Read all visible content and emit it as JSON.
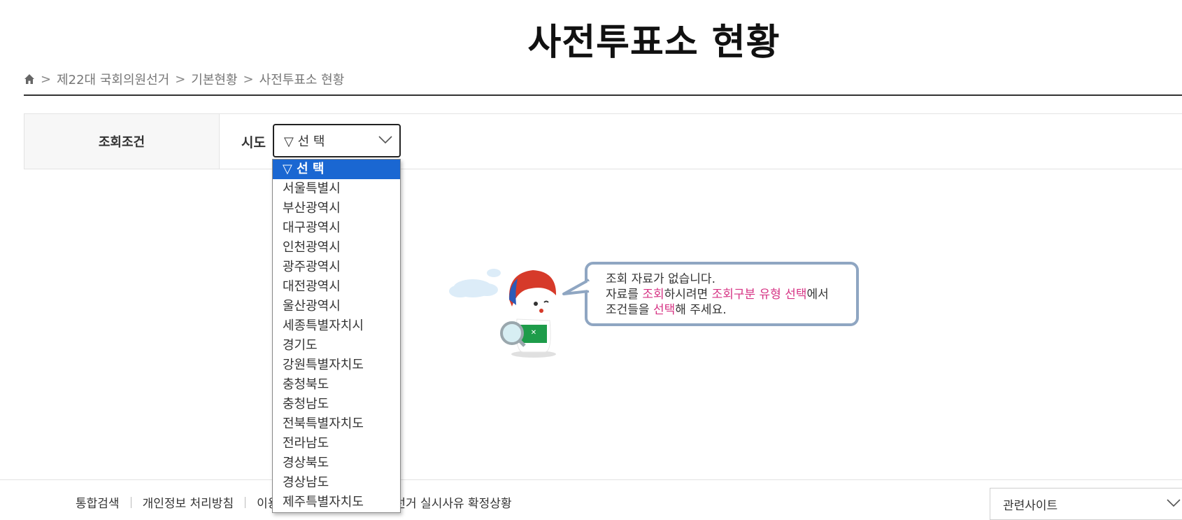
{
  "page": {
    "title": "사전투표소 현황"
  },
  "breadcrumb": {
    "sep": ">",
    "items": [
      "제22대 국회의원선거",
      "기본현황",
      "사전투표소 현황"
    ]
  },
  "filter": {
    "label": "조회조건",
    "sido_label": "시도",
    "selected": "▽ 선 택",
    "options": [
      "▽ 선 택",
      "서울특별시",
      "부산광역시",
      "대구광역시",
      "인천광역시",
      "광주광역시",
      "대전광역시",
      "울산광역시",
      "세종특별자치시",
      "경기도",
      "강원특별자치도",
      "충청북도",
      "충청남도",
      "전북특별자치도",
      "전라남도",
      "경상북도",
      "경상남도",
      "제주특별자치도"
    ]
  },
  "empty_message": {
    "line1": "조회 자료가 없습니다.",
    "line2_a": "자료를 ",
    "line2_b": "조회",
    "line2_c": "하시려면 ",
    "line2_d": "조회구분 유형 선택",
    "line2_e": "에서",
    "line3_a": "조건들을 ",
    "line3_b": "선택",
    "line3_c": "해 주세요."
  },
  "footer": {
    "links": [
      "통합검색",
      "개인정보 처리방침",
      "이용",
      "선거 실시사유 확정상황"
    ],
    "related": "관련사이트"
  },
  "colors": {
    "accent": "#1a67d2",
    "highlight": "#d63384",
    "bubble_border": "#8fa6c2"
  }
}
